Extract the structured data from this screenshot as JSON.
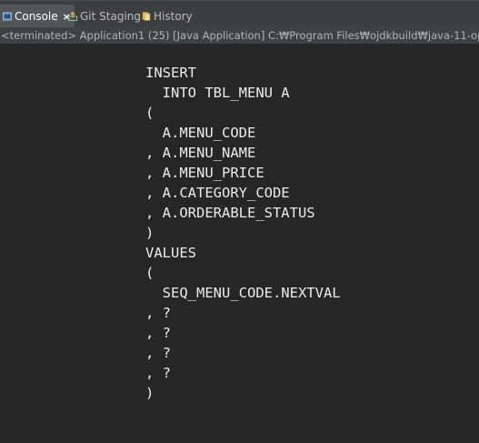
{
  "tabs": [
    {
      "label": "Console",
      "icon": "console-icon",
      "active": true,
      "closable": true
    },
    {
      "label": "Git Staging",
      "icon": "git-staging-icon",
      "active": false
    },
    {
      "label": "History",
      "icon": "history-icon",
      "active": false
    }
  ],
  "close_glyph": "×",
  "status_text": "<terminated> Application1 (25) [Java Application] C:₩Program Files₩ojdkbuild₩java-11-openjdk-",
  "console_lines": [
    "INSERT",
    "  INTO TBL_MENU A",
    "(",
    "  A.MENU_CODE",
    ", A.MENU_NAME",
    ", A.MENU_PRICE",
    ", A.CATEGORY_CODE",
    ", A.ORDERABLE_STATUS",
    ")",
    "VALUES",
    "(",
    "  SEQ_MENU_CODE.NEXTVAL",
    ", ?",
    ", ?",
    ", ?",
    ", ?",
    ")"
  ],
  "colors": {
    "background": "#262626",
    "tabbar": "#3c3f41",
    "active_tab": "#515658",
    "text": "#ebebeb",
    "console_icon": "#6f9fd8"
  }
}
